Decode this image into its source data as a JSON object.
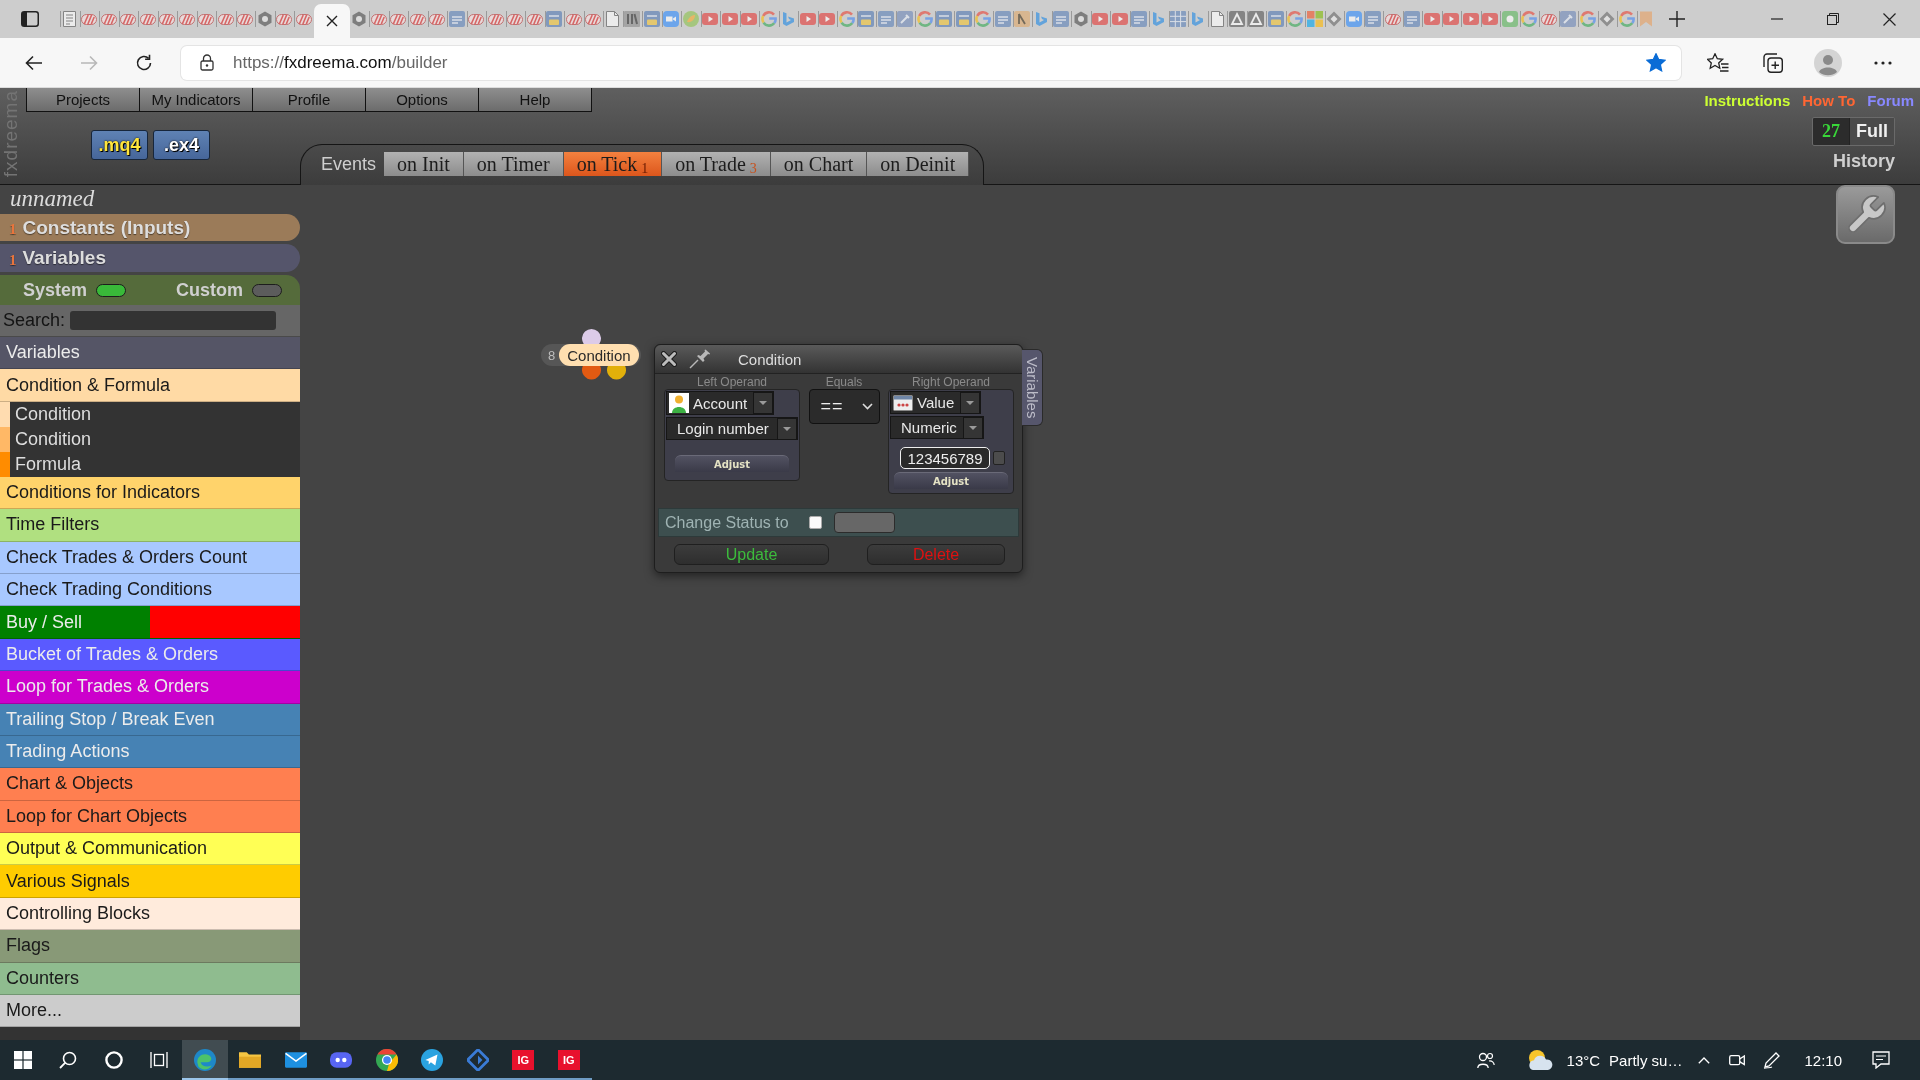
{
  "browser": {
    "tabs": [
      {
        "kind": "list",
        "selected": false
      },
      {
        "kind": "stripe",
        "selected": false
      },
      {
        "kind": "stripe",
        "selected": false
      },
      {
        "kind": "stripe",
        "selected": false
      },
      {
        "kind": "stripe",
        "selected": false
      },
      {
        "kind": "stripe",
        "selected": false
      },
      {
        "kind": "stripe",
        "selected": false
      },
      {
        "kind": "stripe",
        "selected": false
      },
      {
        "kind": "stripe",
        "selected": false
      },
      {
        "kind": "stripe",
        "selected": false
      },
      {
        "kind": "hex",
        "selected": false
      },
      {
        "kind": "stripe",
        "selected": false
      },
      {
        "kind": "stripe",
        "selected": false
      },
      {
        "selected": true
      },
      {
        "kind": "hex",
        "selected": false
      },
      {
        "kind": "stripe",
        "selected": false
      },
      {
        "kind": "stripe",
        "selected": false
      },
      {
        "kind": "stripe",
        "selected": false
      },
      {
        "kind": "stripe",
        "selected": false
      },
      {
        "kind": "mql",
        "selected": false
      },
      {
        "kind": "stripe",
        "selected": false
      },
      {
        "kind": "stripe",
        "selected": false
      },
      {
        "kind": "stripe",
        "selected": false
      },
      {
        "kind": "stripe",
        "selected": false
      },
      {
        "kind": "mq5",
        "selected": false
      },
      {
        "kind": "stripe",
        "selected": false
      },
      {
        "kind": "stripe",
        "selected": false
      },
      {
        "kind": "doc",
        "selected": false
      },
      {
        "kind": "ki",
        "selected": false
      },
      {
        "kind": "mq5",
        "selected": false
      },
      {
        "kind": "zoom",
        "selected": false
      },
      {
        "kind": "leaf",
        "selected": false
      },
      {
        "kind": "play",
        "selected": false
      },
      {
        "kind": "play",
        "selected": false
      },
      {
        "kind": "play",
        "selected": false
      },
      {
        "kind": "google",
        "selected": false
      },
      {
        "kind": "bing",
        "selected": false
      },
      {
        "kind": "play",
        "selected": false
      },
      {
        "kind": "play",
        "selected": false
      },
      {
        "kind": "google",
        "selected": false
      },
      {
        "kind": "mq5",
        "selected": false
      },
      {
        "kind": "mql",
        "selected": false
      },
      {
        "kind": "tool",
        "selected": false
      },
      {
        "kind": "google",
        "selected": false
      },
      {
        "kind": "mq5",
        "selected": false
      },
      {
        "kind": "mq5",
        "selected": false
      },
      {
        "kind": "google",
        "selected": false
      },
      {
        "kind": "mql",
        "selected": false
      },
      {
        "kind": "serif",
        "selected": false
      },
      {
        "kind": "bing",
        "selected": false
      },
      {
        "kind": "mql",
        "selected": false
      },
      {
        "kind": "hex",
        "selected": false
      },
      {
        "kind": "play",
        "selected": false
      },
      {
        "kind": "play",
        "selected": false
      },
      {
        "kind": "mql",
        "selected": false
      },
      {
        "kind": "bing",
        "selected": false
      },
      {
        "kind": "grid",
        "selected": false
      },
      {
        "kind": "bing",
        "selected": false
      },
      {
        "kind": "doc",
        "selected": false
      },
      {
        "kind": "triangle",
        "selected": false
      },
      {
        "kind": "triangle",
        "selected": false
      },
      {
        "kind": "mq5",
        "selected": false
      },
      {
        "kind": "google",
        "selected": false
      },
      {
        "kind": "windows",
        "selected": false
      },
      {
        "kind": "diamond",
        "selected": false
      },
      {
        "kind": "zoom",
        "selected": false
      },
      {
        "kind": "mql",
        "selected": false
      },
      {
        "kind": "stripe",
        "selected": false
      },
      {
        "kind": "mql",
        "selected": false
      },
      {
        "kind": "play",
        "selected": false
      },
      {
        "kind": "play",
        "selected": false
      },
      {
        "kind": "play",
        "selected": false
      },
      {
        "kind": "play",
        "selected": false
      },
      {
        "kind": "green",
        "selected": false
      },
      {
        "kind": "google",
        "selected": false
      },
      {
        "kind": "stripe",
        "selected": false
      },
      {
        "kind": "tool",
        "selected": false
      },
      {
        "kind": "google",
        "selected": false
      },
      {
        "kind": "diamond",
        "selected": false
      },
      {
        "kind": "google",
        "selected": false
      },
      {
        "kind": "bookmark",
        "selected": false
      }
    ],
    "url": {
      "scheme": "https://",
      "host": "fxdreema.com",
      "path": "/builder"
    },
    "forward_disabled": true,
    "bookmarked": true
  },
  "app": {
    "logo": "fxdreema",
    "menu": [
      "Projects",
      "My Indicators",
      "Profile",
      "Options",
      "Help"
    ],
    "links": [
      {
        "label": "Instructions",
        "color": "#ccff33"
      },
      {
        "label": "How To",
        "color": "#ff6633"
      },
      {
        "label": "Forum",
        "color": "#8888ff"
      }
    ],
    "exports": [
      {
        "label": ".mq4",
        "kind": "mq4"
      },
      {
        "label": ".ex4",
        "kind": "ex4"
      }
    ],
    "events": {
      "label": "Events",
      "tabs": [
        {
          "label": "on Init",
          "selected": false
        },
        {
          "label": "on Timer",
          "selected": false
        },
        {
          "label": "on Tick",
          "count": "1",
          "selected": true
        },
        {
          "label": "on Trade",
          "count": "3",
          "selected": false
        },
        {
          "label": "on Chart",
          "selected": false
        },
        {
          "label": "on Deinit",
          "selected": false
        }
      ]
    },
    "history": {
      "count": "27",
      "mode": "Full",
      "label": "History"
    }
  },
  "sidebar": {
    "project": "unnamed",
    "constants": {
      "count": "1",
      "label": "Constants (Inputs)"
    },
    "variables": {
      "count": "1",
      "label": "Variables"
    },
    "filters": [
      {
        "label": "System",
        "on": true
      },
      {
        "label": "Custom",
        "on": false
      }
    ],
    "search": {
      "label": "Search:"
    },
    "categories": [
      {
        "label": "Variables",
        "color": "#555566"
      },
      {
        "label": "Condition & Formula",
        "color": "#ffdaa5",
        "children": [
          {
            "label": "Condition",
            "color": "#ffdcb0"
          },
          {
            "label": "Condition",
            "color": "#ffb866"
          },
          {
            "label": "Formula",
            "color": "#ff8c00"
          }
        ]
      },
      {
        "label": "Conditions for Indicators",
        "color": "#ffd36b"
      },
      {
        "label": "Time Filters",
        "color": "#b0e080"
      },
      {
        "label": "Check Trades & Orders Count",
        "color": "#a8c8ff"
      },
      {
        "label": "Check Trading Conditions",
        "color": "#a8c8ff"
      },
      {
        "label": "Buy / Sell",
        "color": "#008000",
        "band": {
          "color": "#ff0000"
        }
      },
      {
        "label": "Bucket of Trades & Orders",
        "color": "#5a5aff"
      },
      {
        "label": "Loop for Trades & Orders",
        "color": "#cc00cc"
      },
      {
        "label": "Trailing Stop / Break Even",
        "color": "#4682b4"
      },
      {
        "label": "Trading Actions",
        "color": "#4682b4"
      },
      {
        "label": "Chart & Objects",
        "color": "#ff7f50"
      },
      {
        "label": "Loop for Chart Objects",
        "color": "#ff7f50"
      },
      {
        "label": "Output & Communication",
        "color": "#ffff55"
      },
      {
        "label": "Various Signals",
        "color": "#ffcc00"
      },
      {
        "label": "Controlling Blocks",
        "color": "#ffebdc"
      },
      {
        "label": "Flags",
        "color": "#889977"
      },
      {
        "label": "Counters",
        "color": "#8fbc8f"
      },
      {
        "label": "More...",
        "color": "#cccccc"
      }
    ]
  },
  "canvas": {
    "node": {
      "number": "8",
      "label": "Condition"
    },
    "dialog": {
      "title": "Condition",
      "side_tab": "Variables",
      "left": {
        "heading": "Left Operand",
        "source": "Account",
        "field": "Login number",
        "button": "Adjust"
      },
      "operator": {
        "heading": "Equals",
        "value": "=="
      },
      "right": {
        "heading": "Right Operand",
        "source": "Value",
        "type": "Numeric",
        "value": "123456789",
        "checked": false,
        "button": "Adjust"
      },
      "status": {
        "label": "Change Status to",
        "checked": false
      },
      "buttons": [
        {
          "label": "Update",
          "kind": "update"
        },
        {
          "label": "Delete",
          "kind": "delete"
        }
      ]
    }
  },
  "taskbar": {
    "apps": [
      {
        "kind": "swirl",
        "selected": true,
        "running": true
      },
      {
        "kind": "folder",
        "selected": false,
        "running": true
      },
      {
        "kind": "mail",
        "selected": false,
        "running": true
      },
      {
        "kind": "gamepad",
        "selected": false,
        "running": true
      },
      {
        "kind": "wheel",
        "selected": false,
        "running": true
      },
      {
        "kind": "plane",
        "selected": false,
        "running": true
      },
      {
        "kind": "diamond",
        "selected": false,
        "running": true
      },
      {
        "kind": "badge",
        "label": "IG",
        "selected": false,
        "running": true
      },
      {
        "kind": "badge",
        "label": "IG",
        "selected": false,
        "running": true
      }
    ],
    "weather": {
      "temperature": "13°C",
      "condition": "Partly su…"
    },
    "time": "12:10"
  }
}
